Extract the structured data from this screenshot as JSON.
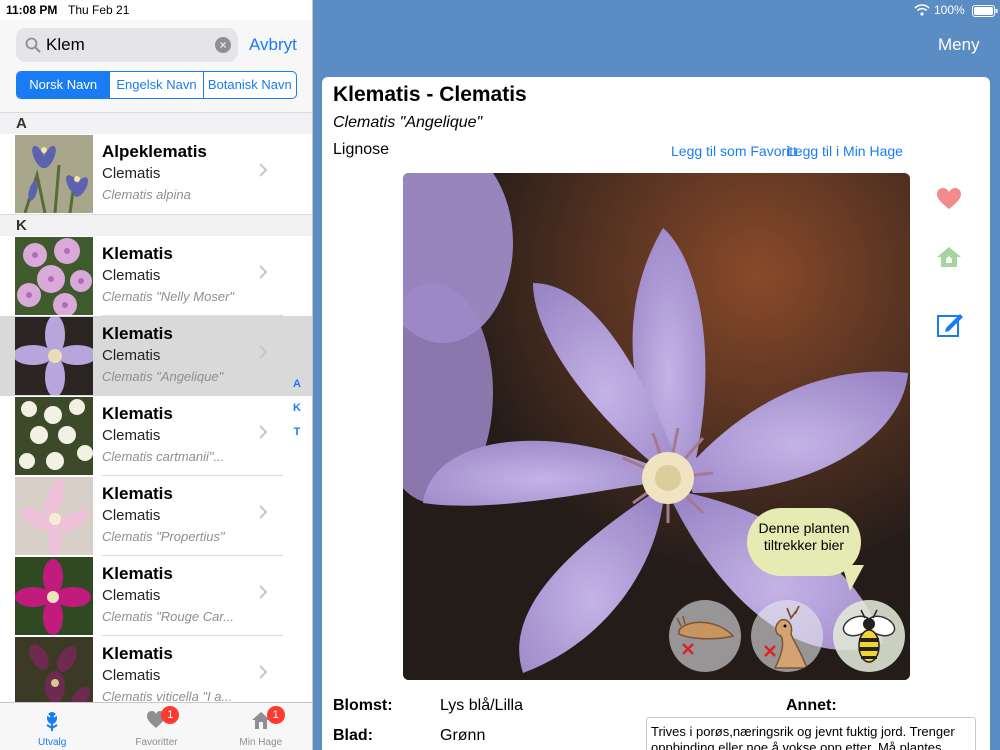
{
  "status_bar": {
    "time": "11:08 PM",
    "date": "Thu Feb 21",
    "battery": "100%"
  },
  "search": {
    "query": "Klem",
    "cancel_label": "Avbryt"
  },
  "name_filter": {
    "segments": [
      "Norsk Navn",
      "Engelsk Navn",
      "Botanisk Navn"
    ],
    "selected": "Norsk Navn"
  },
  "sections": [
    {
      "letter": "A",
      "plants": [
        {
          "name": "Alpeklematis",
          "english": "Clematis",
          "botanical": "Clematis alpina"
        }
      ]
    },
    {
      "letter": "K",
      "plants": [
        {
          "name": "Klematis",
          "english": "Clematis",
          "botanical": "Clematis \"Nelly Moser\""
        },
        {
          "name": "Klematis",
          "english": "Clematis",
          "botanical": "Clematis \"Angelique\"",
          "selected": true
        },
        {
          "name": "Klematis",
          "english": "Clematis",
          "botanical": "Clematis cartmanii\"..."
        },
        {
          "name": "Klematis",
          "english": "Clematis",
          "botanical": "Clematis \"Propertius\""
        },
        {
          "name": "Klematis",
          "english": "Clematis",
          "botanical": "Clematis \"Rouge Car..."
        },
        {
          "name": "Klematis",
          "english": "Clematis",
          "botanical": "Clematis viticella \"I a..."
        }
      ]
    }
  ],
  "index_letters": [
    "A",
    "K",
    "T"
  ],
  "tabs": [
    {
      "label": "Utvalg",
      "icon": "flower-icon",
      "active": true
    },
    {
      "label": "Favoritter",
      "icon": "heart-icon",
      "badge": "1"
    },
    {
      "label": "Min Hage",
      "icon": "house-icon",
      "badge": "1"
    }
  ],
  "nav": {
    "menu_label": "Meny"
  },
  "detail": {
    "title": "Klematis - Clematis",
    "botanical": "Clematis \"Angelique\"",
    "type": "Lignose",
    "add_favorite_label": "Legg til som Favoritt",
    "add_garden_label": "Legg til i Min Hage",
    "bee_message": "Denne planten tiltrekker bier",
    "blomst_label": "Blomst:",
    "blomst_value": "Lys blå/Lilla",
    "blad_label": "Blad:",
    "blad_value": "Grønn",
    "annet_label": "Annet:",
    "annet_text": "Trives i porøs,næringsrik og jevnt fuktig jord. Trenger oppbinding eller noe å vokse opp etter. Må plantes"
  },
  "colors": {
    "accent": "#1a7cf5",
    "nav_bar": "#5b8cc4",
    "heart": "#f28b8b",
    "house": "#a6d49e",
    "badge": "#ff3b30"
  }
}
